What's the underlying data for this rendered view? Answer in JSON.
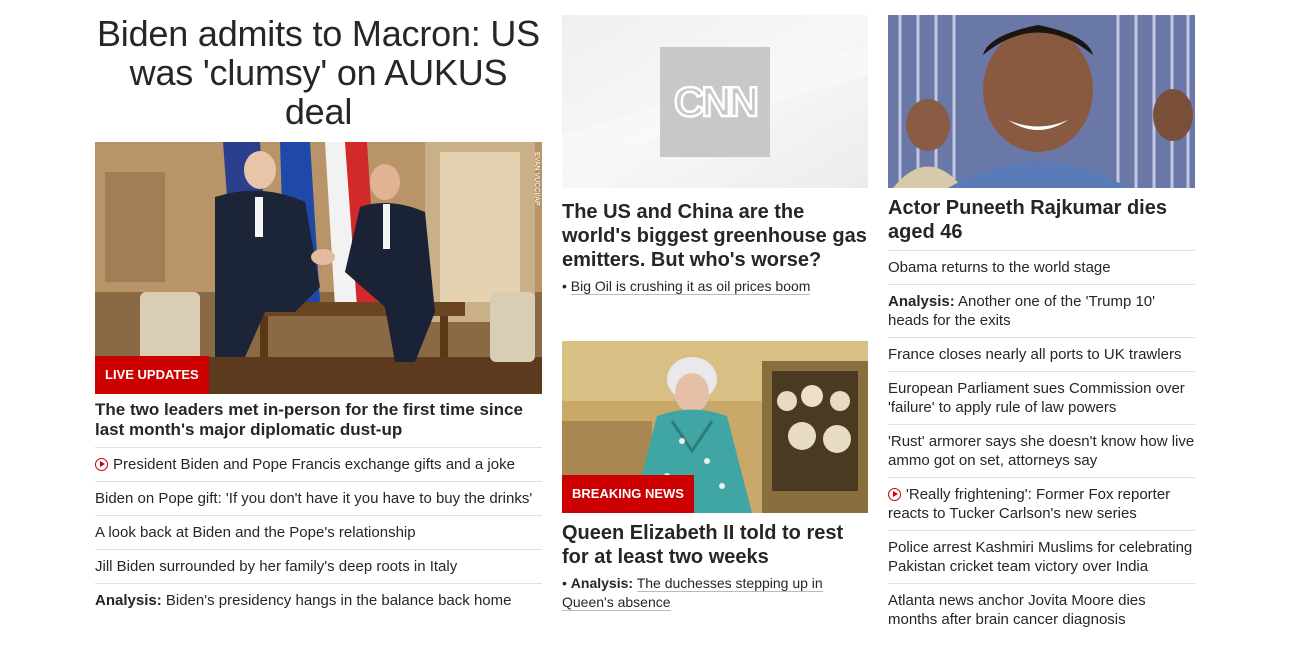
{
  "lead": {
    "headline": "Biden admits to Macron: US was 'clumsy' on AUKUS deal",
    "badge": "LIVE UPDATES",
    "photo_credit": "EVAN VUCCI/AP",
    "subheadline": "The two leaders met in-person for the first time since last month's major diplomatic dust-up",
    "links": [
      {
        "prefix": "",
        "text": "President Biden and Pope Francis exchange gifts and a joke",
        "video": true
      },
      {
        "prefix": "",
        "text": "Biden on Pope gift: 'If you don't have it you have to buy the drinks'",
        "video": false
      },
      {
        "prefix": "",
        "text": "A look back at Biden and the Pope's relationship",
        "video": false
      },
      {
        "prefix": "",
        "text": "Jill Biden surrounded by her family's deep roots in Italy",
        "video": false
      },
      {
        "prefix": "Analysis:",
        "text": "Biden's presidency hangs in the balance back home",
        "video": false
      }
    ]
  },
  "middle": {
    "story1": {
      "logo_text": "CNN",
      "headline": "The US and China are the world's biggest greenhouse gas emitters. But who's worse?",
      "link_bullet": "•",
      "link": "Big Oil is crushing it as oil prices boom"
    },
    "story2": {
      "badge": "BREAKING NEWS",
      "headline": "Queen Elizabeth II told to rest for at least two weeks",
      "link_bullet": "•",
      "link_prefix": "Analysis:",
      "link": "The duchesses stepping up in Queen's absence"
    }
  },
  "right": {
    "headline": "Actor Puneeth Rajkumar dies aged 46",
    "links": [
      {
        "prefix": "",
        "text": "Obama returns to the world stage",
        "video": false
      },
      {
        "prefix": "Analysis:",
        "text": "Another one of the 'Trump 10' heads for the exits",
        "video": false
      },
      {
        "prefix": "",
        "text": "France closes nearly all ports to UK trawlers",
        "video": false
      },
      {
        "prefix": "",
        "text": "European Parliament sues Commission over 'failure' to apply rule of law powers",
        "video": false
      },
      {
        "prefix": "",
        "text": "'Rust' armorer says she doesn't know how live ammo got on set, attorneys say",
        "video": false
      },
      {
        "prefix": "",
        "text": "'Really frightening': Former Fox reporter reacts to Tucker Carlson's new series",
        "video": true
      },
      {
        "prefix": "",
        "text": "Police arrest Kashmiri Muslims for celebrating Pakistan cricket team victory over India",
        "video": false
      },
      {
        "prefix": "",
        "text": "Atlanta news anchor Jovita Moore dies months after brain cancer diagnosis",
        "video": false
      }
    ]
  },
  "colors": {
    "accent": "#cc0000",
    "text": "#262626",
    "divider": "#e1e1e1"
  }
}
